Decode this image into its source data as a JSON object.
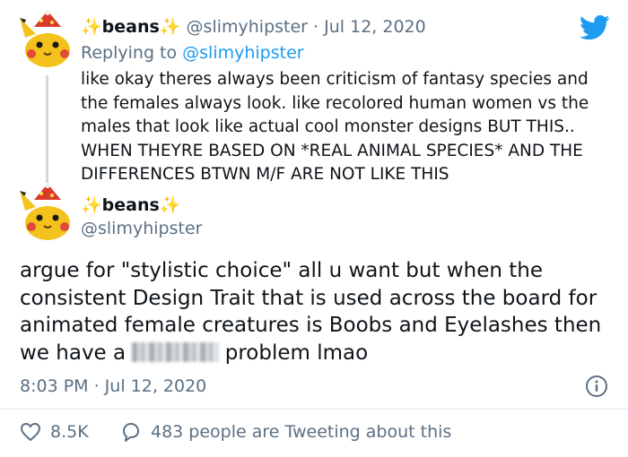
{
  "tweet1": {
    "name": "beans",
    "sparkle": "✨",
    "handle": "@slimyhipster",
    "separator": "·",
    "date": "Jul 12, 2020",
    "replying_prefix": "Replying to ",
    "replying_handle": "@slimyhipster",
    "text": "like okay theres always been criticism of fantasy species and the females always look. like recolored human women vs the males that look like actual cool monster designs BUT THIS.. WHEN THEYRE BASED ON *REAL ANIMAL SPECIES* AND THE DIFFERENCES BTWN M/F ARE NOT LIKE THIS"
  },
  "tweet2": {
    "name": "beans",
    "sparkle": "✨",
    "handle": "@slimyhipster",
    "text_before": "argue for \"stylistic choice\" all u want but when the consistent Design Trait that is used across the board for animated female creatures is Boobs and Eyelashes then we have a ",
    "text_after": " problem lmao",
    "timestamp": "8:03 PM · Jul 12, 2020"
  },
  "actions": {
    "likes": "8.5K",
    "conversation": "483 people are Tweeting about this"
  },
  "colors": {
    "brand_blue": "#1d9bf0",
    "muted": "#5b7083",
    "sparkle": "#e8b81a"
  },
  "icons": [
    "twitter-bird-icon",
    "info-icon",
    "heart-icon",
    "reply-bubble-icon"
  ]
}
